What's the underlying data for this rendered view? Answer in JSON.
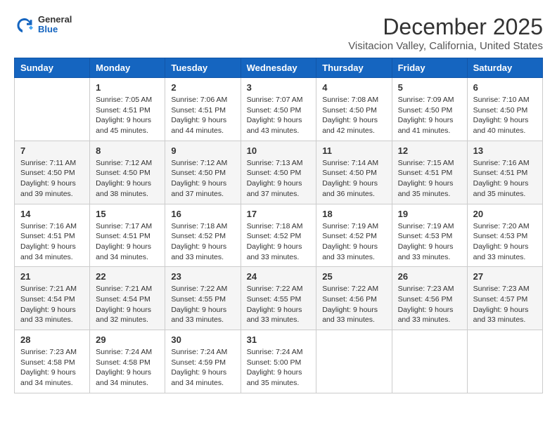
{
  "header": {
    "logo": {
      "general": "General",
      "blue": "Blue"
    },
    "title": "December 2025",
    "location": "Visitacion Valley, California, United States"
  },
  "days_of_week": [
    "Sunday",
    "Monday",
    "Tuesday",
    "Wednesday",
    "Thursday",
    "Friday",
    "Saturday"
  ],
  "weeks": [
    [
      {
        "day": "",
        "info": ""
      },
      {
        "day": "1",
        "sunrise": "Sunrise: 7:05 AM",
        "sunset": "Sunset: 4:51 PM",
        "daylight": "Daylight: 9 hours and 45 minutes."
      },
      {
        "day": "2",
        "sunrise": "Sunrise: 7:06 AM",
        "sunset": "Sunset: 4:51 PM",
        "daylight": "Daylight: 9 hours and 44 minutes."
      },
      {
        "day": "3",
        "sunrise": "Sunrise: 7:07 AM",
        "sunset": "Sunset: 4:50 PM",
        "daylight": "Daylight: 9 hours and 43 minutes."
      },
      {
        "day": "4",
        "sunrise": "Sunrise: 7:08 AM",
        "sunset": "Sunset: 4:50 PM",
        "daylight": "Daylight: 9 hours and 42 minutes."
      },
      {
        "day": "5",
        "sunrise": "Sunrise: 7:09 AM",
        "sunset": "Sunset: 4:50 PM",
        "daylight": "Daylight: 9 hours and 41 minutes."
      },
      {
        "day": "6",
        "sunrise": "Sunrise: 7:10 AM",
        "sunset": "Sunset: 4:50 PM",
        "daylight": "Daylight: 9 hours and 40 minutes."
      }
    ],
    [
      {
        "day": "7",
        "sunrise": "Sunrise: 7:11 AM",
        "sunset": "Sunset: 4:50 PM",
        "daylight": "Daylight: 9 hours and 39 minutes."
      },
      {
        "day": "8",
        "sunrise": "Sunrise: 7:12 AM",
        "sunset": "Sunset: 4:50 PM",
        "daylight": "Daylight: 9 hours and 38 minutes."
      },
      {
        "day": "9",
        "sunrise": "Sunrise: 7:12 AM",
        "sunset": "Sunset: 4:50 PM",
        "daylight": "Daylight: 9 hours and 37 minutes."
      },
      {
        "day": "10",
        "sunrise": "Sunrise: 7:13 AM",
        "sunset": "Sunset: 4:50 PM",
        "daylight": "Daylight: 9 hours and 37 minutes."
      },
      {
        "day": "11",
        "sunrise": "Sunrise: 7:14 AM",
        "sunset": "Sunset: 4:50 PM",
        "daylight": "Daylight: 9 hours and 36 minutes."
      },
      {
        "day": "12",
        "sunrise": "Sunrise: 7:15 AM",
        "sunset": "Sunset: 4:51 PM",
        "daylight": "Daylight: 9 hours and 35 minutes."
      },
      {
        "day": "13",
        "sunrise": "Sunrise: 7:16 AM",
        "sunset": "Sunset: 4:51 PM",
        "daylight": "Daylight: 9 hours and 35 minutes."
      }
    ],
    [
      {
        "day": "14",
        "sunrise": "Sunrise: 7:16 AM",
        "sunset": "Sunset: 4:51 PM",
        "daylight": "Daylight: 9 hours and 34 minutes."
      },
      {
        "day": "15",
        "sunrise": "Sunrise: 7:17 AM",
        "sunset": "Sunset: 4:51 PM",
        "daylight": "Daylight: 9 hours and 34 minutes."
      },
      {
        "day": "16",
        "sunrise": "Sunrise: 7:18 AM",
        "sunset": "Sunset: 4:52 PM",
        "daylight": "Daylight: 9 hours and 33 minutes."
      },
      {
        "day": "17",
        "sunrise": "Sunrise: 7:18 AM",
        "sunset": "Sunset: 4:52 PM",
        "daylight": "Daylight: 9 hours and 33 minutes."
      },
      {
        "day": "18",
        "sunrise": "Sunrise: 7:19 AM",
        "sunset": "Sunset: 4:52 PM",
        "daylight": "Daylight: 9 hours and 33 minutes."
      },
      {
        "day": "19",
        "sunrise": "Sunrise: 7:19 AM",
        "sunset": "Sunset: 4:53 PM",
        "daylight": "Daylight: 9 hours and 33 minutes."
      },
      {
        "day": "20",
        "sunrise": "Sunrise: 7:20 AM",
        "sunset": "Sunset: 4:53 PM",
        "daylight": "Daylight: 9 hours and 33 minutes."
      }
    ],
    [
      {
        "day": "21",
        "sunrise": "Sunrise: 7:21 AM",
        "sunset": "Sunset: 4:54 PM",
        "daylight": "Daylight: 9 hours and 33 minutes."
      },
      {
        "day": "22",
        "sunrise": "Sunrise: 7:21 AM",
        "sunset": "Sunset: 4:54 PM",
        "daylight": "Daylight: 9 hours and 32 minutes."
      },
      {
        "day": "23",
        "sunrise": "Sunrise: 7:22 AM",
        "sunset": "Sunset: 4:55 PM",
        "daylight": "Daylight: 9 hours and 33 minutes."
      },
      {
        "day": "24",
        "sunrise": "Sunrise: 7:22 AM",
        "sunset": "Sunset: 4:55 PM",
        "daylight": "Daylight: 9 hours and 33 minutes."
      },
      {
        "day": "25",
        "sunrise": "Sunrise: 7:22 AM",
        "sunset": "Sunset: 4:56 PM",
        "daylight": "Daylight: 9 hours and 33 minutes."
      },
      {
        "day": "26",
        "sunrise": "Sunrise: 7:23 AM",
        "sunset": "Sunset: 4:56 PM",
        "daylight": "Daylight: 9 hours and 33 minutes."
      },
      {
        "day": "27",
        "sunrise": "Sunrise: 7:23 AM",
        "sunset": "Sunset: 4:57 PM",
        "daylight": "Daylight: 9 hours and 33 minutes."
      }
    ],
    [
      {
        "day": "28",
        "sunrise": "Sunrise: 7:23 AM",
        "sunset": "Sunset: 4:58 PM",
        "daylight": "Daylight: 9 hours and 34 minutes."
      },
      {
        "day": "29",
        "sunrise": "Sunrise: 7:24 AM",
        "sunset": "Sunset: 4:58 PM",
        "daylight": "Daylight: 9 hours and 34 minutes."
      },
      {
        "day": "30",
        "sunrise": "Sunrise: 7:24 AM",
        "sunset": "Sunset: 4:59 PM",
        "daylight": "Daylight: 9 hours and 34 minutes."
      },
      {
        "day": "31",
        "sunrise": "Sunrise: 7:24 AM",
        "sunset": "Sunset: 5:00 PM",
        "daylight": "Daylight: 9 hours and 35 minutes."
      },
      {
        "day": "",
        "info": ""
      },
      {
        "day": "",
        "info": ""
      },
      {
        "day": "",
        "info": ""
      }
    ]
  ]
}
